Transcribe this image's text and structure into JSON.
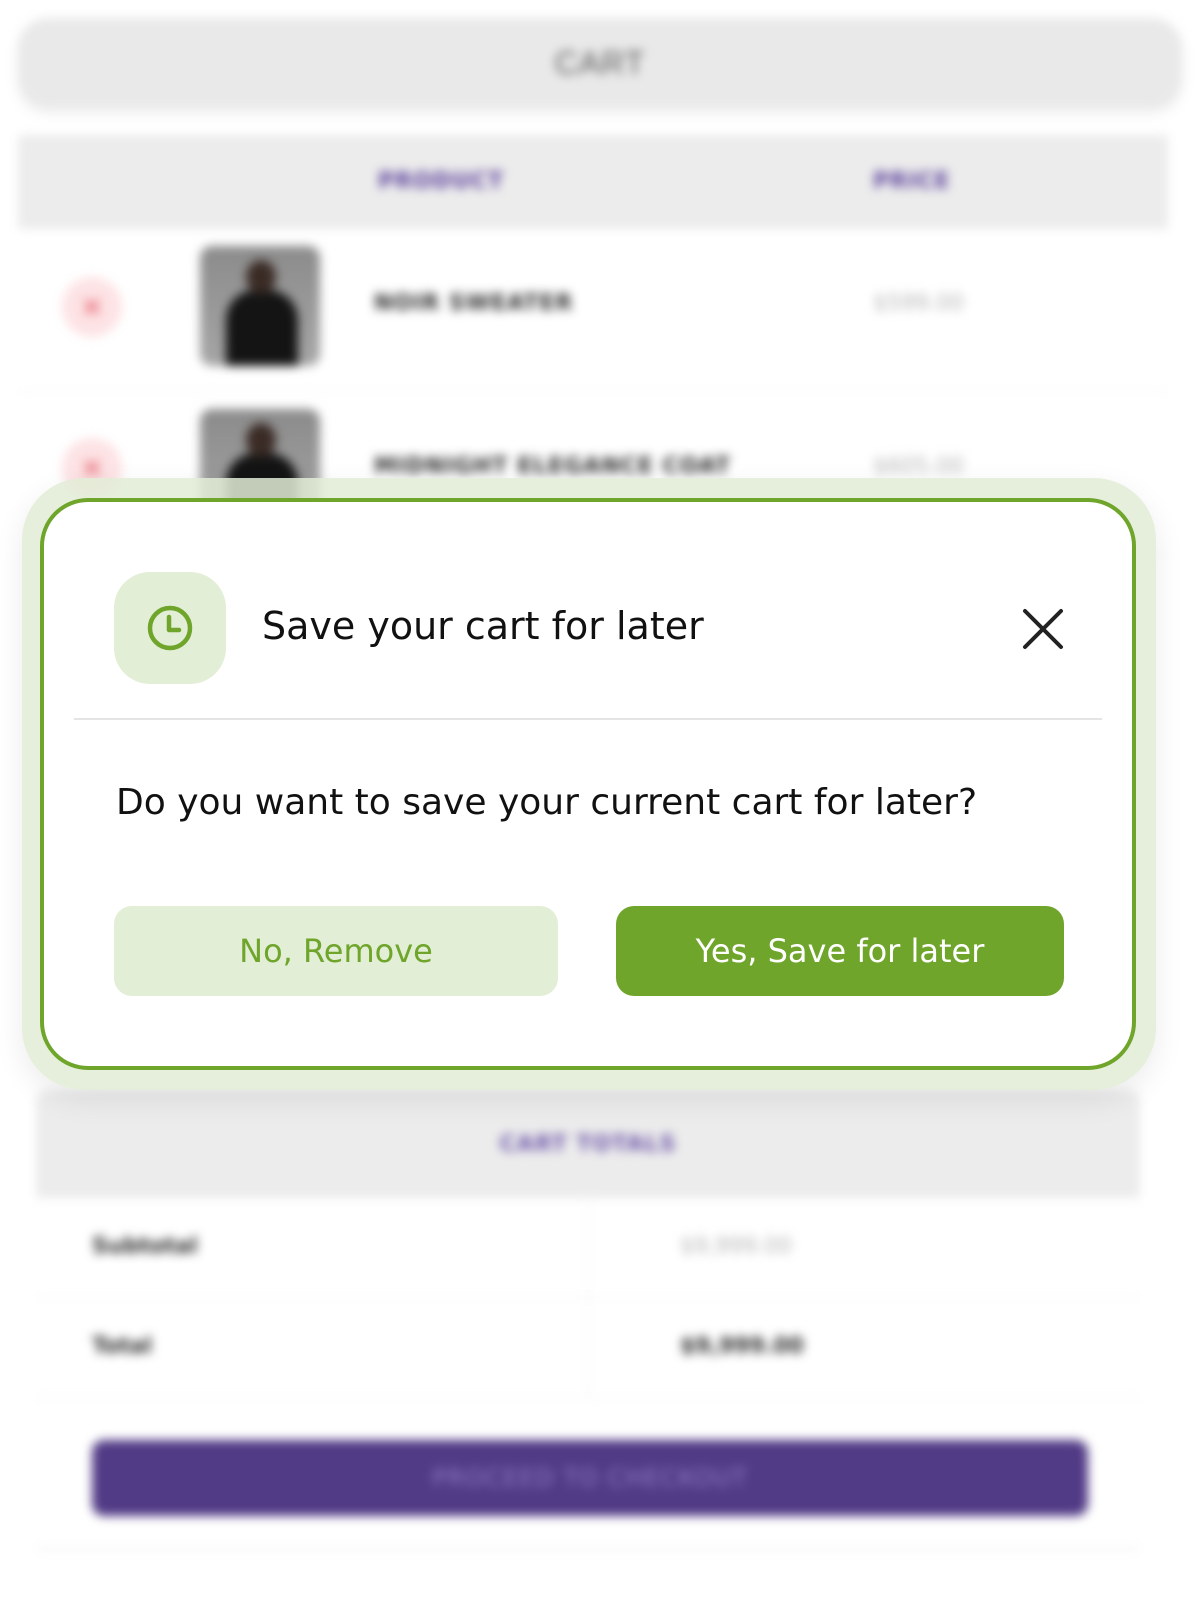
{
  "cart": {
    "title": "CART",
    "columns": {
      "product": "PRODUCT",
      "price": "PRICE"
    },
    "items": [
      {
        "name": "NOIR SWEATER",
        "price": "$599.00",
        "remove_icon": "x-icon"
      },
      {
        "name": "MIDNIGHT ELEGANCE COAT",
        "price": "$605.00",
        "remove_icon": "x-icon"
      }
    ]
  },
  "totals": {
    "title": "CART TOTALS",
    "subtotal_label": "Subtotal",
    "subtotal_value": "$9,999.00",
    "total_label": "Total",
    "total_value": "$9,999.00"
  },
  "checkout": {
    "label": "PROCEED TO CHECKOUT"
  },
  "modal": {
    "icon": "clock-icon",
    "title": "Save your cart for later",
    "message": "Do you want to save your current cart for later?",
    "secondary_label": "No, Remove",
    "primary_label": "Yes, Save for later",
    "close_icon": "close-icon"
  },
  "colors": {
    "accent_green": "#6fa52b",
    "light_green": "#e2eed5",
    "brand_purple": "#523b86",
    "remove_red": "#e35a66"
  }
}
